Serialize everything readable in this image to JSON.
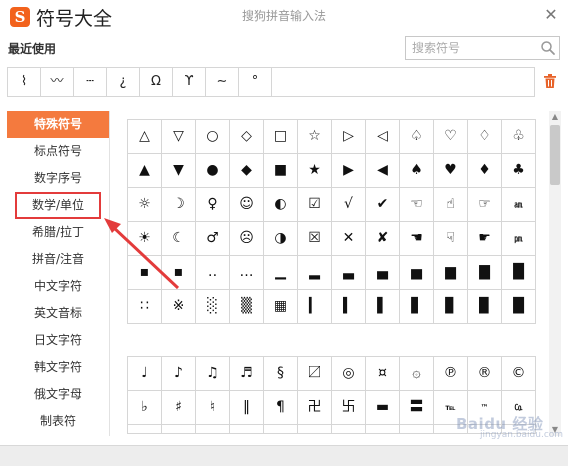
{
  "window": {
    "logo_char": "S",
    "title": "符号大全",
    "subtitle": "搜狗拼音输入法",
    "close_glyph": "✕"
  },
  "recent": {
    "label": "最近使用",
    "items": [
      "⌇",
      "〰",
      "┄",
      "¿",
      "Ω",
      "ϒ",
      "∼",
      "°"
    ]
  },
  "search": {
    "placeholder": "搜索符号",
    "value": ""
  },
  "sidebar": {
    "items": [
      {
        "label": "特殊符号",
        "active": true
      },
      {
        "label": "标点符号"
      },
      {
        "label": "数字序号"
      },
      {
        "label": "数学/单位",
        "highlighted": true
      },
      {
        "label": "希腊/拉丁"
      },
      {
        "label": "拼音/注音"
      },
      {
        "label": "中文字符"
      },
      {
        "label": "英文音标"
      },
      {
        "label": "日文字符"
      },
      {
        "label": "韩文字符"
      },
      {
        "label": "俄文字母"
      },
      {
        "label": "制表符"
      }
    ]
  },
  "grid1": {
    "cells": [
      "△",
      "▽",
      "○",
      "◇",
      "□",
      "☆",
      "▷",
      "◁",
      "♤",
      "♡",
      "♢",
      "♧",
      "▲",
      "▼",
      "●",
      "◆",
      "■",
      "★",
      "▶",
      "◀",
      "♠",
      "♥",
      "♦",
      "♣",
      "☼",
      "☽",
      "♀",
      "☺",
      "◐",
      "☑",
      "√",
      "✔",
      "☜",
      "☝",
      "☞",
      "㏂",
      "☀",
      "☾",
      "♂",
      "☹",
      "◑",
      "☒",
      "✕",
      "✘",
      "☚",
      "☟",
      "☛",
      "㏘",
      "▪",
      "▪",
      "‥",
      "…",
      "▁",
      "▂",
      "▃",
      "▄",
      "▅",
      "▆",
      "▇",
      "█",
      "∷",
      "※",
      "░",
      "▒",
      "▦",
      "▎",
      "▍",
      "▌",
      "▋",
      "▊",
      "▉",
      "█"
    ]
  },
  "grid2": {
    "cells": [
      "♩",
      "♪",
      "♫",
      "♬",
      "§",
      "〼",
      "◎",
      "¤",
      "۞",
      "℗",
      "®",
      "©",
      "♭",
      "♯",
      "♮",
      "‖",
      "¶",
      "卍",
      "卐",
      "▬",
      "〓",
      "℡",
      "™",
      "㏇",
      "",
      "",
      "",
      "",
      "",
      "",
      "",
      "",
      "",
      "",
      "",
      ""
    ]
  },
  "watermark": {
    "brand": "Baidu 经验",
    "url": "jingyan.baidu.com"
  },
  "colors": {
    "accent": "#f47a3e",
    "highlight_border": "#e33b3b",
    "logo": "#f2621c"
  }
}
